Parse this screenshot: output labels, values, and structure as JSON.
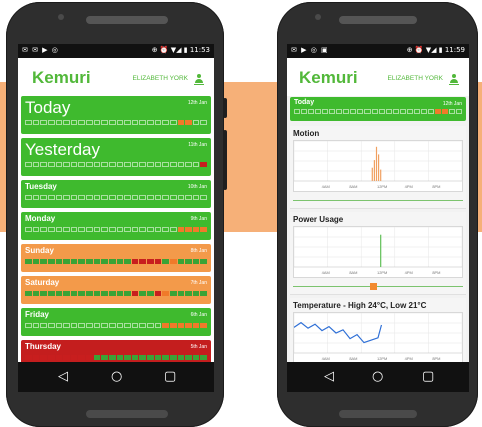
{
  "app": {
    "logo": "Kemuri",
    "user_name": "ELIZABETH YORK"
  },
  "phone_left": {
    "status_icons": "✉ ✉ ▶ ◎",
    "status_right": "⊕ ⏰ ▼◢ ▮ 11:53",
    "days": [
      {
        "name": "Today",
        "date": "12th Jan",
        "color": "#3fba2e",
        "size": "big",
        "segments": "eeeeeeeeeeeeeeeeeeeeooeeeeeeeeeeeeeeeeeeeeee"
      },
      {
        "name": "Yesterday",
        "date": "11th Jan",
        "color": "#3fba2e",
        "size": "big",
        "segments": "eeeeeeeeeeeeeeeeeeeeeeerrreeeeeeeeeeeeeeeeeeee"
      },
      {
        "name": "Tuesday",
        "date": "10th Jan",
        "color": "#3fba2e",
        "size": "small",
        "segments": "eeeeeeeeeeeeeeeeeeeeeeeeeeeeeeeeeeeeeeeeeeeeee"
      },
      {
        "name": "Monday",
        "date": "9th Jan",
        "color": "#3fba2e",
        "size": "small",
        "segments": "eeeeeeeeeeeeeeeeeeeeooooeeeeeeeeeeeeeeeeeeeeee"
      },
      {
        "name": "Sunday",
        "date": "8th Jan",
        "color": "#f39a4a",
        "size": "small",
        "segments": "ggggggggggggggrrrrgoggggggggggggggggggggggggggg"
      },
      {
        "name": "Saturday",
        "date": "7th Jan",
        "color": "#f39a4a",
        "size": "small",
        "segments": "ggggggggggggggrggroggggggggggggggggggggggggggg"
      },
      {
        "name": "Friday",
        "date": "6th Jan",
        "color": "#3fba2e",
        "size": "small",
        "segments": "eeeeeeeeeeeeeeeeeeoooooooeeeeeeeeeeeeeeeeeeeee"
      },
      {
        "name": "Thursday",
        "date": "5th Jan",
        "color": "#c41e1e",
        "size": "small",
        "segments": "rrrrrrrrrggggggggggggggggggggggggggggggggggggggg"
      }
    ],
    "nav": {
      "back": "◁",
      "home": "○",
      "recent": "▢"
    }
  },
  "phone_right": {
    "status_icons": "✉ ▶ ◎ ▣",
    "status_right": "⊕ ⏰ ▼◢ ▮ 11:59",
    "today": {
      "name": "Today",
      "date": "12th Jan",
      "segments": "eeeeeeeeeeeeeeeeeeeeooeeeeeeeeeeeeeeeeeeeeee"
    },
    "graphs": [
      {
        "title": "Motion",
        "ticks": [
          "4AM",
          "8AM",
          "12PM",
          "4PM",
          "8PM"
        ]
      },
      {
        "title": "Power Usage",
        "ticks": [
          "4AM",
          "8AM",
          "12PM",
          "4PM",
          "8PM"
        ]
      },
      {
        "title": "Temperature - High 24°C, Low 21°C",
        "ticks": [
          "4AM",
          "8AM",
          "12PM",
          "4PM",
          "8PM"
        ]
      }
    ],
    "motion_data": {
      "type": "bar",
      "x_hours": [
        11.1,
        11.4,
        11.7,
        12.0,
        12.3
      ],
      "values": [
        0.35,
        0.55,
        0.9,
        0.7,
        0.3
      ],
      "xlim": [
        0,
        24
      ]
    },
    "power_data": {
      "type": "bar",
      "x_hours": [
        12.3
      ],
      "values": [
        0.85
      ],
      "xlim": [
        0,
        24
      ]
    },
    "temperature_data": {
      "type": "line",
      "x_hours": [
        0,
        1,
        2,
        3,
        4,
        5,
        6,
        7,
        8,
        9,
        10,
        11,
        12,
        12.5
      ],
      "y_celsius": [
        23.2,
        23.8,
        23.1,
        23.6,
        22.8,
        23.3,
        22.5,
        22.9,
        21.8,
        22.3,
        21.3,
        21.6,
        21.9,
        23.5
      ],
      "xlim": [
        0,
        24
      ],
      "ylim": [
        20,
        25
      ]
    },
    "nav": {
      "back": "◁",
      "home": "○",
      "recent": "▢"
    }
  }
}
